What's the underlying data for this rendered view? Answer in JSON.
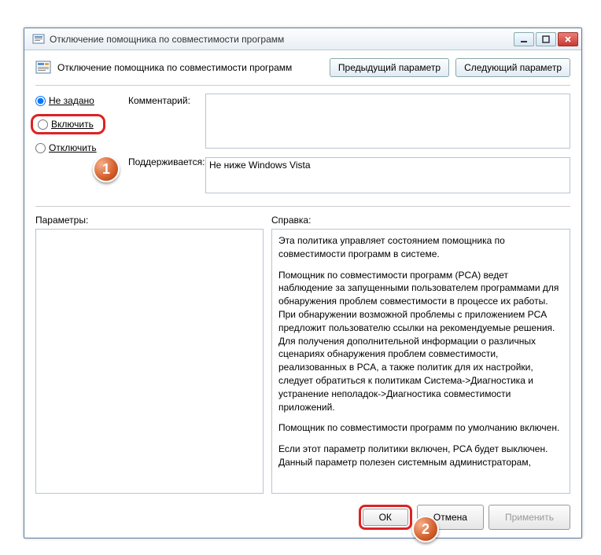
{
  "window": {
    "title": "Отключение помощника по совместимости программ"
  },
  "header": {
    "title": "Отключение помощника по совместимости программ",
    "prev": "Предыдущий параметр",
    "next": "Следующий параметр"
  },
  "radios": {
    "not_set": "Не задано",
    "enable": "Включить",
    "disable": "Отключить"
  },
  "labels": {
    "comment": "Комментарий:",
    "supported_label": "Поддерживается:",
    "supported_value": "Не ниже Windows Vista",
    "params": "Параметры:",
    "help": "Справка:"
  },
  "help": {
    "p1": "Эта политика управляет состоянием помощника по совместимости программ в системе.",
    "p2": "Помощник по совместимости программ (PCA) ведет наблюдение за запущенными пользователем программами для обнаружения проблем совместимости в процессе их работы. При обнаружении возможной проблемы с приложением PCA предложит пользователю ссылки на рекомендуемые решения.  Для получения дополнительной информации о различных сценариях обнаружения проблем совместимости, реализованных в PCA, а также политик для их настройки, следует обратиться к политикам Система->Диагностика и устранение неполадок->Диагностика совместимости приложений.",
    "p3": "Помощник по совместимости программ по умолчанию включен.",
    "p4": "Если этот параметр политики включен, PCA будет выключен. Данный параметр полезен системным администраторам,"
  },
  "footer": {
    "ok": "ОК",
    "cancel": "Отмена",
    "apply": "Применить"
  },
  "callouts": {
    "one": "1",
    "two": "2"
  }
}
